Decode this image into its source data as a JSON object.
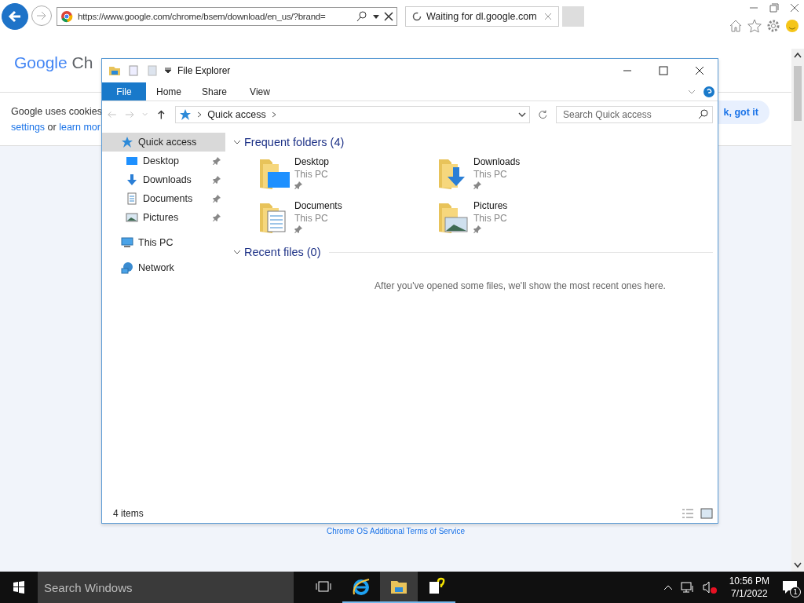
{
  "browser": {
    "address": "https://www.google.com/chrome/bsem/download/en_us/?brand=",
    "tabs": [
      {
        "title": "Waiting for dl.google.com",
        "selected": true
      }
    ]
  },
  "page": {
    "logo_google": "Google",
    "logo_rest": "Ch",
    "cookie_text": "Google uses cookies",
    "cookie_links": [
      {
        "text": "settings",
        "kind": "link"
      },
      {
        "text": " or ",
        "kind": "text"
      },
      {
        "text": "learn mor",
        "kind": "link"
      }
    ],
    "cookie_button": "k, got it",
    "footer_link": "Chrome OS Additional Terms of Service"
  },
  "explorer": {
    "title": "File Explorer",
    "ribbon_tabs": [
      {
        "label": "File",
        "selected": true
      },
      {
        "label": "Home",
        "selected": false
      },
      {
        "label": "Share",
        "selected": false
      },
      {
        "label": "View",
        "selected": false
      }
    ],
    "breadcrumb": "Quick access",
    "search": {
      "placeholder": "Search Quick access"
    },
    "nav": [
      {
        "label": "Quick access",
        "kind": "star",
        "selected": true,
        "children": [
          {
            "label": "Desktop",
            "kind": "desktop",
            "selected": false,
            "pinned": true
          },
          {
            "label": "Downloads",
            "kind": "download",
            "selected": false,
            "pinned": true
          },
          {
            "label": "Documents",
            "kind": "document",
            "selected": false,
            "pinned": true
          },
          {
            "label": "Pictures",
            "kind": "pictures",
            "selected": false,
            "pinned": true
          }
        ]
      },
      {
        "label": "This PC",
        "kind": "pc",
        "selected": false
      },
      {
        "label": "Network",
        "kind": "network",
        "selected": false
      }
    ],
    "sections": [
      {
        "title": "Frequent folders (4)",
        "expanded": true,
        "folders": [
          {
            "name": "Desktop",
            "location": "This PC",
            "kind": "desktop",
            "pinned": true
          },
          {
            "name": "Downloads",
            "location": "This PC",
            "kind": "download",
            "pinned": true
          },
          {
            "name": "Documents",
            "location": "This PC",
            "kind": "document",
            "pinned": true
          },
          {
            "name": "Pictures",
            "location": "This PC",
            "kind": "pictures",
            "pinned": true
          }
        ]
      },
      {
        "title": "Recent files (0)",
        "expanded": true,
        "empty_text": "After you've opened some files, we'll show the most recent ones here."
      }
    ],
    "status": "4 items"
  },
  "taskbar": {
    "search": {
      "placeholder": "Search Windows"
    },
    "apps": [
      {
        "kind": "ie",
        "selected": false
      },
      {
        "kind": "folder",
        "selected": true
      },
      {
        "kind": "help",
        "selected": false
      }
    ],
    "time": "10:56 PM",
    "date": "7/1/2022",
    "notifications": "1"
  }
}
